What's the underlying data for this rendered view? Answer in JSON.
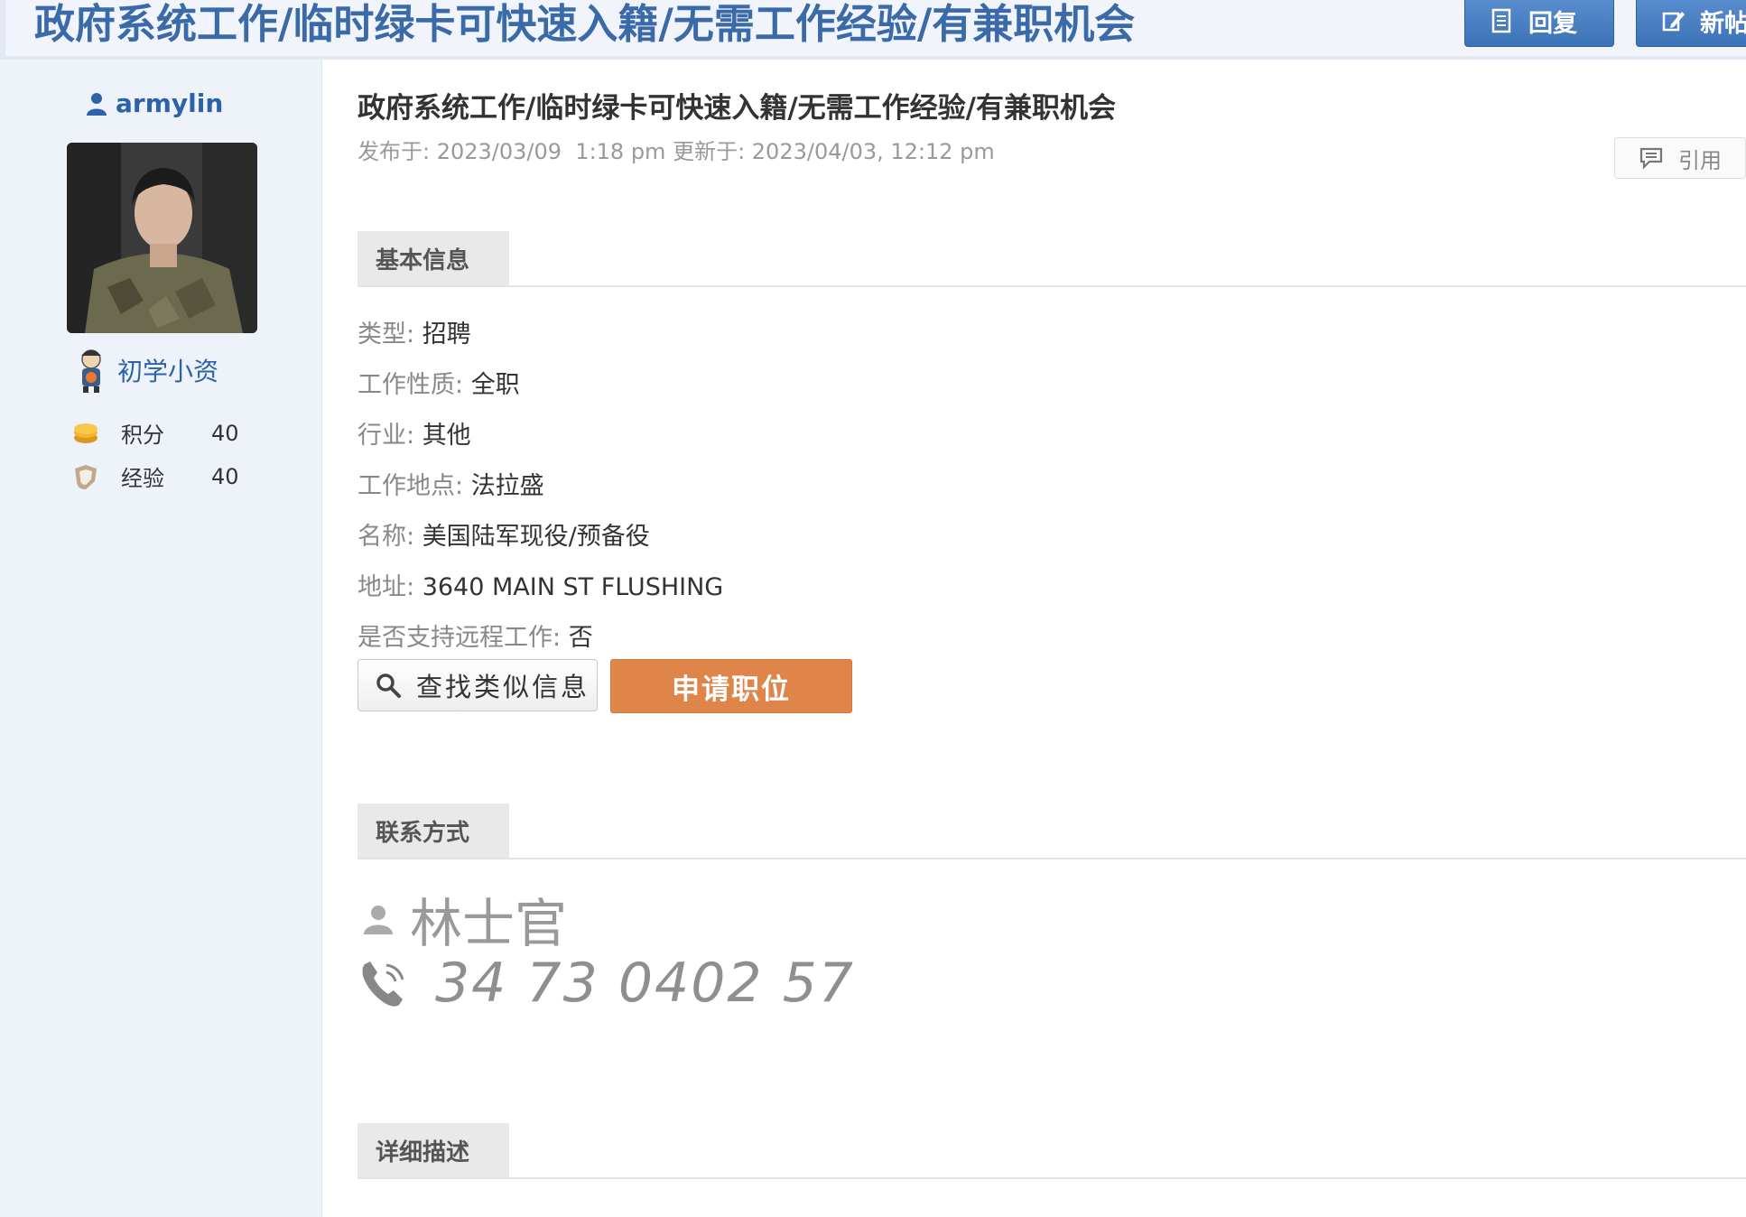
{
  "header": {
    "title": "政府系统工作/临时绿卡可快速入籍/无需工作经验/有兼职机会",
    "reply_label": "回复",
    "new_post_label": "新帖"
  },
  "sidebar": {
    "username": "armylin",
    "rank": "初学小资",
    "stats": [
      {
        "label": "积分",
        "value": "40",
        "icon": "coin-icon"
      },
      {
        "label": "经验",
        "value": "40",
        "icon": "shield-icon"
      }
    ]
  },
  "post": {
    "title": "政府系统工作/临时绿卡可快速入籍/无需工作经验/有兼职机会",
    "meta": "发布于: 2023/03/09  1:18 pm 更新于: 2023/04/03, 12:12 pm",
    "quote_label": "引用"
  },
  "basic_info": {
    "heading": "基本信息",
    "fields": [
      {
        "key": "类型",
        "value": "招聘"
      },
      {
        "key": "工作性质",
        "value": "全职"
      },
      {
        "key": "行业",
        "value": "其他"
      },
      {
        "key": "工作地点",
        "value": "法拉盛"
      },
      {
        "key": "名称",
        "value": "美国陆军现役/预备役"
      },
      {
        "key": "地址",
        "value": "3640 MAIN ST FLUSHING"
      },
      {
        "key": "是否支持远程工作",
        "value": "否"
      }
    ],
    "search_label": "查找类似信息",
    "apply_label": "申请职位"
  },
  "contact": {
    "heading": "联系方式",
    "name": "林士官",
    "phone": "34 73 0402 57"
  },
  "detail": {
    "heading": "详细描述"
  },
  "colors": {
    "accent_blue": "#3c72b7",
    "apply_orange": "#e0854a",
    "sidebar_bg": "#eef3fa"
  }
}
